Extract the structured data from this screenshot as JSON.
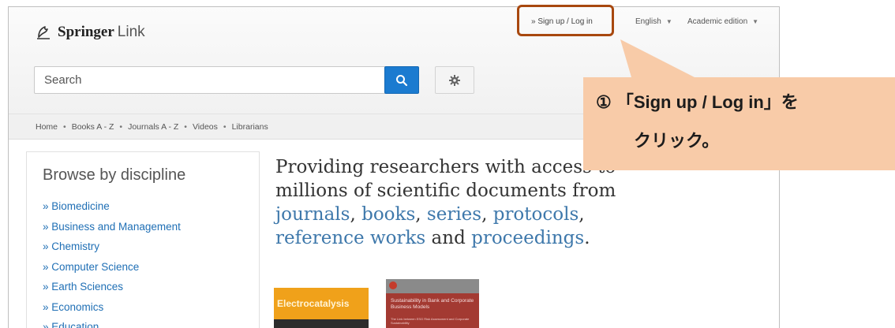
{
  "header": {
    "logo": {
      "brand": "Springer",
      "suffix": "Link"
    },
    "signup_link": "» Sign up / Log in",
    "language": "English",
    "edition": "Academic edition"
  },
  "search": {
    "placeholder": "Search"
  },
  "nav": {
    "items": [
      "Home",
      "Books A - Z",
      "Journals A - Z",
      "Videos",
      "Librarians"
    ],
    "separator": "•"
  },
  "sidebar": {
    "title": "Browse by discipline",
    "items": [
      "» Biomedicine",
      "» Business and Management",
      "» Chemistry",
      "» Computer Science",
      "» Earth Sciences",
      "» Economics",
      "» Education"
    ]
  },
  "hero": {
    "line1": "Providing researchers with access to",
    "line2": "millions of scientific documents from",
    "journals": "journals",
    "books": "books",
    "series": "series",
    "protocols": "protocols",
    "reference_works": "reference works",
    "and": "and",
    "proceedings": "proceedings",
    "comma": ",",
    "period": "."
  },
  "books": [
    {
      "title": "Electrocatalysis"
    },
    {
      "title": "Sustainability in Bank and Corporate Business Models",
      "subtitle": "The Link between ESG Risk Assessment and Corporate Sustainability"
    }
  ],
  "annotation": {
    "line1": "① 「Sign up / Log in」を",
    "line2": "クリック。",
    "fill_color": "#f8cba8",
    "highlight_color": "#a8480f"
  },
  "colors": {
    "accent": "#1b7bd0",
    "link": "#1f6fb5",
    "hero_link": "#3e78ab"
  }
}
